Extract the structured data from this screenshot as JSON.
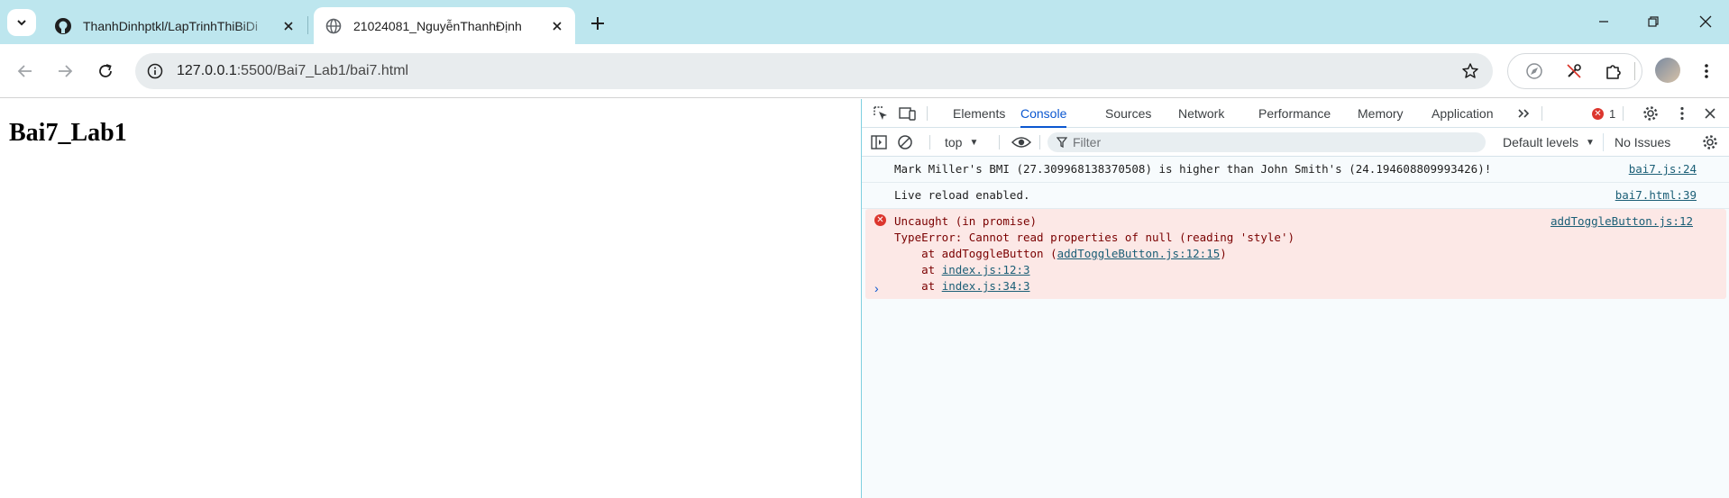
{
  "browser": {
    "tabs": [
      {
        "title": "ThanhDinhptkl/LapTrinhThiBiDi",
        "favicon": "github-icon",
        "active": false
      },
      {
        "title": "21024081_NguyễnThanhĐịnh",
        "favicon": "globe-icon",
        "active": true
      }
    ],
    "url_host": "127.0.0.1",
    "url_path": ":5500/Bai7_Lab1/bai7.html"
  },
  "page": {
    "heading": "Bai7_Lab1"
  },
  "devtools": {
    "tabs": [
      "Elements",
      "Console",
      "Sources",
      "Network",
      "Performance",
      "Memory",
      "Application"
    ],
    "active_tab": "Console",
    "error_count": "1",
    "context": "top",
    "filter_placeholder": "Filter",
    "levels": "Default levels",
    "issues": "No Issues",
    "messages": [
      {
        "text": "Mark Miller's BMI (27.309968138370508) is higher than John Smith's (24.194608809993426)!",
        "source": "bai7.js:24"
      },
      {
        "text": "Live reload enabled.",
        "source": "bai7.html:39"
      }
    ],
    "error": {
      "title": "Uncaught (in promise)",
      "message": "TypeError: Cannot read properties of null (reading 'style')",
      "source": "addToggleButton.js:12",
      "stack_1_prefix": "    at addToggleButton (",
      "stack_1_link": "addToggleButton.js:12:15",
      "stack_1_suffix": ")",
      "stack_2_prefix": "    at ",
      "stack_2_link": "index.js:12:3",
      "stack_3_prefix": "    at ",
      "stack_3_link": "index.js:34:3"
    }
  }
}
